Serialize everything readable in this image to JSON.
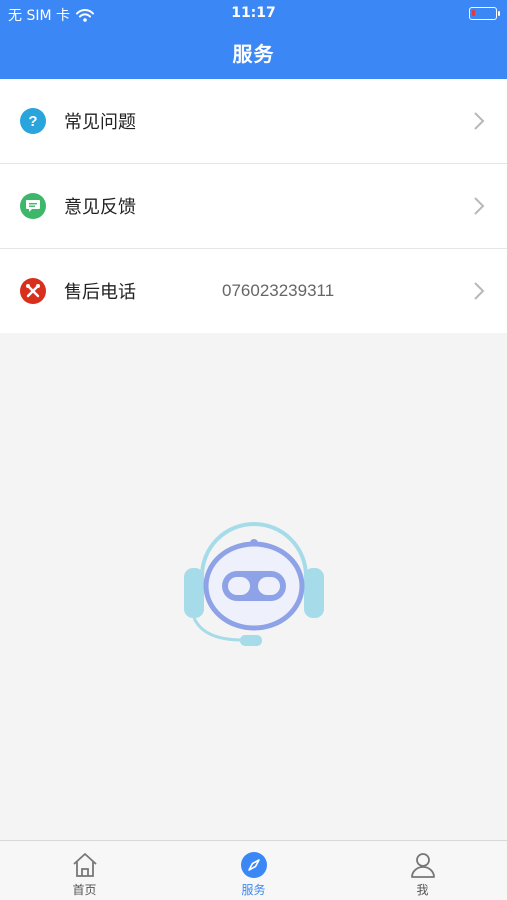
{
  "status_bar": {
    "carrier": "无 SIM 卡",
    "time": "11:17",
    "battery_color": "#e53935"
  },
  "header": {
    "title": "服务",
    "background": "#3b87f6"
  },
  "menu": {
    "items": [
      {
        "label": "常见问题",
        "icon": "question-circle-icon",
        "icon_color": "#2aa4dc",
        "value": ""
      },
      {
        "label": "意见反馈",
        "icon": "chat-bubble-icon",
        "icon_color": "#3db86a",
        "value": ""
      },
      {
        "label": "售后电话",
        "icon": "tools-icon",
        "icon_color": "#d9301d",
        "value": "076023239311"
      }
    ]
  },
  "tabbar": {
    "items": [
      {
        "label": "首页",
        "icon": "home-icon",
        "active": false
      },
      {
        "label": "服务",
        "icon": "compass-icon",
        "active": true
      },
      {
        "label": "我",
        "icon": "user-icon",
        "active": false
      }
    ],
    "active_color": "#3b87f6"
  }
}
